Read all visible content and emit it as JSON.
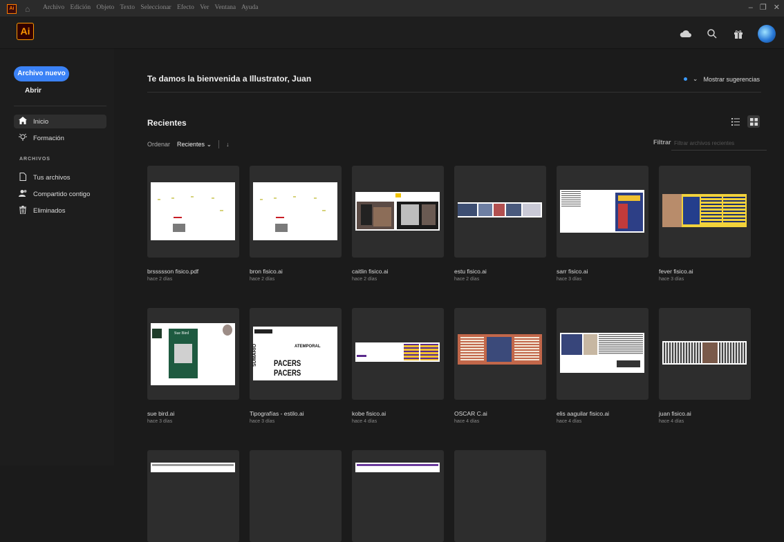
{
  "menubar": {
    "app_icon": "Ai",
    "menus": [
      "Archivo",
      "Edición",
      "Objeto",
      "Texto",
      "Seleccionar",
      "Efecto",
      "Ver",
      "Ventana",
      "Ayuda"
    ]
  },
  "header": {
    "logo": "Ai",
    "icons": [
      "cloud-icon",
      "search-icon",
      "gift-icon",
      "user-avatar"
    ]
  },
  "sidebar": {
    "new_file": "Archivo nuevo",
    "open": "Abrir",
    "nav": [
      {
        "label": "Inicio",
        "icon": "home-icon",
        "active": true
      },
      {
        "label": "Formación",
        "icon": "lightbulb-icon",
        "active": false
      }
    ],
    "section_label": "ARCHIVOS",
    "files_nav": [
      {
        "label": "Tus archivos",
        "icon": "file-icon"
      },
      {
        "label": "Compartido contigo",
        "icon": "shared-users-icon"
      },
      {
        "label": "Eliminados",
        "icon": "trash-icon"
      }
    ]
  },
  "main": {
    "welcome": "Te damos la bienvenida a Illustrator, Juan",
    "suggestions": "Mostrar sugerencias",
    "recent_title": "Recientes",
    "sort_label": "Ordenar",
    "sort_value": "Recientes",
    "filter_label": "Filtrar",
    "filter_placeholder": "Filtrar archivos recientes",
    "files": [
      {
        "name": "brssssson fisico.pdf",
        "date": "hace 2 días"
      },
      {
        "name": "bron fisico.ai",
        "date": "hace 2 días"
      },
      {
        "name": "caitlin fisico.ai",
        "date": "hace 2 días"
      },
      {
        "name": "estu fisico.ai",
        "date": "hace 2 días"
      },
      {
        "name": "sarr fisico.ai",
        "date": "hace 3 días"
      },
      {
        "name": "fever fisico.ai",
        "date": "hace 3 días"
      },
      {
        "name": "sue bird.ai",
        "date": "hace 3 días"
      },
      {
        "name": "Tipografías - estilo.ai",
        "date": "hace 3 días"
      },
      {
        "name": "kobe fisico.ai",
        "date": "hace 4 días"
      },
      {
        "name": "OSCAR C.ai",
        "date": "hace 4 días"
      },
      {
        "name": "elis aaguilar fisico.ai",
        "date": "hace 4 días"
      },
      {
        "name": "juan fisico.ai",
        "date": "hace 4 días"
      }
    ],
    "thumb_text": {
      "sumario": "SUMARIO",
      "atemporal": "ATEMPORAL",
      "pacers": "PACERS",
      "sue_bird": "Sue Bird"
    }
  },
  "colors": {
    "accent": "#3b82f6",
    "brand": "#ff9a00"
  }
}
